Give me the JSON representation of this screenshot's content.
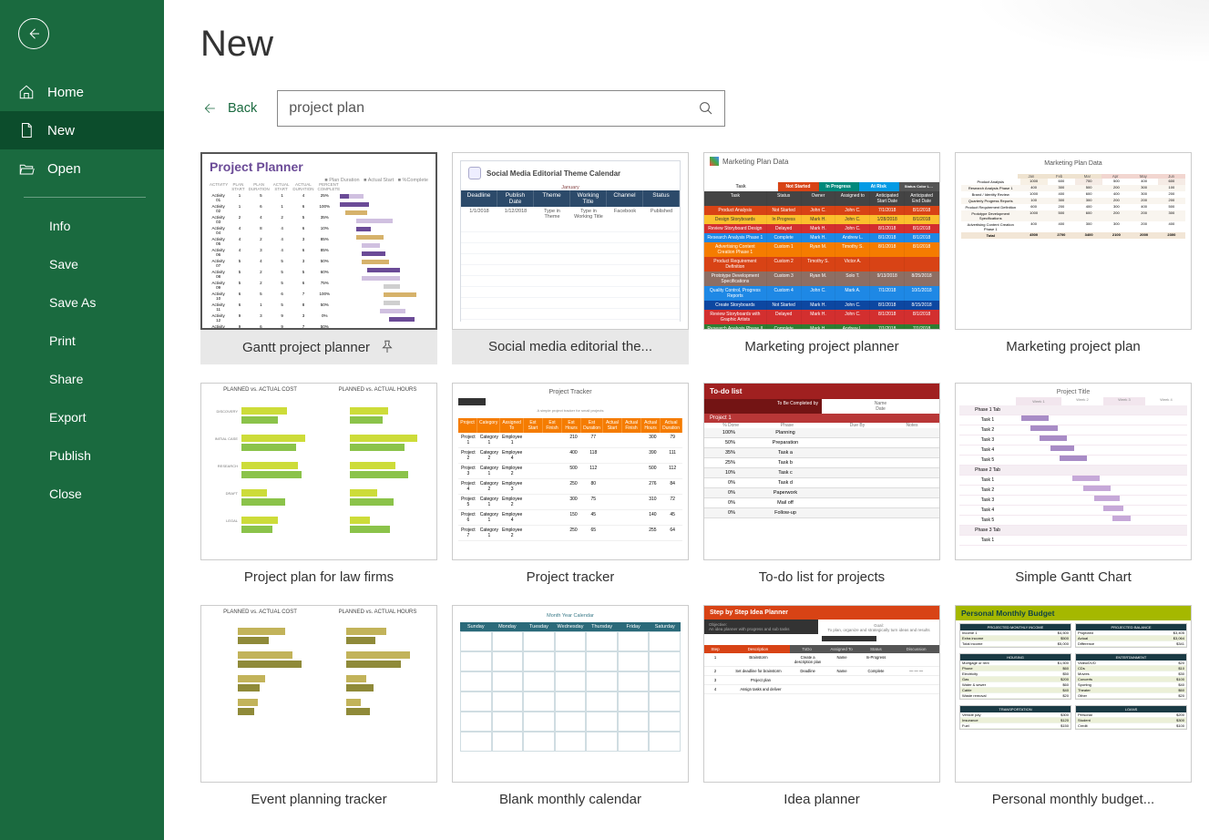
{
  "sidebar": {
    "nav": [
      {
        "label": "Home"
      },
      {
        "label": "New"
      },
      {
        "label": "Open"
      }
    ],
    "menu": [
      {
        "label": "Info"
      },
      {
        "label": "Save"
      },
      {
        "label": "Save As"
      },
      {
        "label": "Print"
      },
      {
        "label": "Share"
      },
      {
        "label": "Export"
      },
      {
        "label": "Publish"
      },
      {
        "label": "Close"
      }
    ]
  },
  "page": {
    "title": "New",
    "back": "Back",
    "search_value": "project plan"
  },
  "templates": [
    {
      "label": "Gantt project planner",
      "selected": true
    },
    {
      "label": "Social media editorial the...",
      "hover": true
    },
    {
      "label": "Marketing project planner"
    },
    {
      "label": "Marketing project plan"
    },
    {
      "label": "Project plan for law firms"
    },
    {
      "label": "Project tracker"
    },
    {
      "label": "To-do list for projects"
    },
    {
      "label": "Simple Gantt Chart"
    },
    {
      "label": "Event planning tracker"
    },
    {
      "label": "Blank monthly calendar"
    },
    {
      "label": "Idea planner"
    },
    {
      "label": "Personal monthly budget..."
    }
  ],
  "thumb_text": {
    "gantt_title": "Project Planner",
    "social_title": "Social Media Editorial Theme Calendar",
    "marketing_title": "Marketing Plan Data",
    "mplan_title": "Marketing Plan Data",
    "law_a": "PLANNED vs. ACTUAL COST",
    "law_b": "PLANNED vs. ACTUAL HOURS",
    "tracker_title": "Project Tracker",
    "todo_title": "To-do list",
    "todo_sub": "To Be Completed by",
    "todo_proj": "Project 1",
    "sg_title": "Project Title",
    "event_a": "PLANNED vs. ACTUAL COST",
    "event_b": "PLANNED vs. ACTUAL HOURS",
    "cal_tabs": "Month   Year   Calendar",
    "idea_title": "Step by Step Idea Planner",
    "budget_title": "Personal Monthly Budget"
  }
}
